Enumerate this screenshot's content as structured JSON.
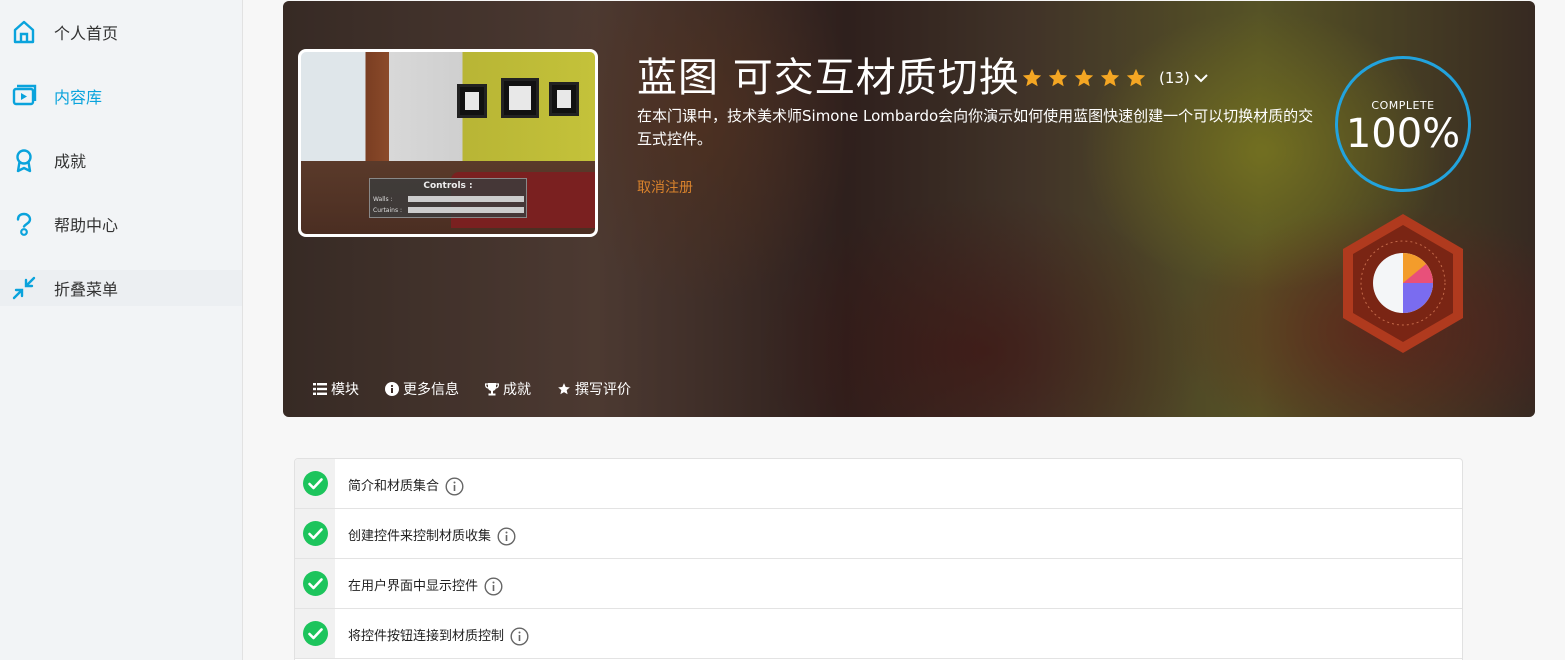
{
  "sidebar": {
    "items": [
      {
        "label": "个人首页",
        "icon": "home-icon",
        "active": false
      },
      {
        "label": "内容库",
        "icon": "library-icon",
        "active": true
      },
      {
        "label": "成就",
        "icon": "ribbon-icon",
        "active": false
      },
      {
        "label": "帮助中心",
        "icon": "help-icon",
        "active": false
      },
      {
        "label": "折叠菜单",
        "icon": "collapse-icon",
        "active": false
      }
    ]
  },
  "course": {
    "title": "蓝图 可交互材质切换",
    "rating": 5,
    "review_count": "(13)",
    "description": "在本门课中，技术美术师Simone Lombardo会向你演示如何使用蓝图快速创建一个可以切换材质的交互式控件。",
    "unenroll_label": "取消注册",
    "complete_label": "COMPLETE",
    "complete_value": "100%",
    "thumbnail": {
      "controls_title": "Controls :",
      "row1_label": "Walls :",
      "row2_label": "Curtains :"
    }
  },
  "tabs": [
    {
      "label": "模块",
      "icon": "list-icon"
    },
    {
      "label": "更多信息",
      "icon": "info-icon"
    },
    {
      "label": "成就",
      "icon": "trophy-icon"
    },
    {
      "label": "撰写评价",
      "icon": "star-icon"
    }
  ],
  "modules": [
    {
      "title": "简介和材质集合",
      "completed": true
    },
    {
      "title": "创建控件来控制材质收集",
      "completed": true
    },
    {
      "title": "在用户界面中显示控件",
      "completed": true
    },
    {
      "title": "将控件按钮连接到材质控制",
      "completed": true
    }
  ],
  "colors": {
    "accent": "#0aa3dc",
    "complete_ring": "#22a3dd",
    "unenroll": "#d8822c",
    "check_green": "#1cc45c",
    "star": "#f4a623"
  }
}
